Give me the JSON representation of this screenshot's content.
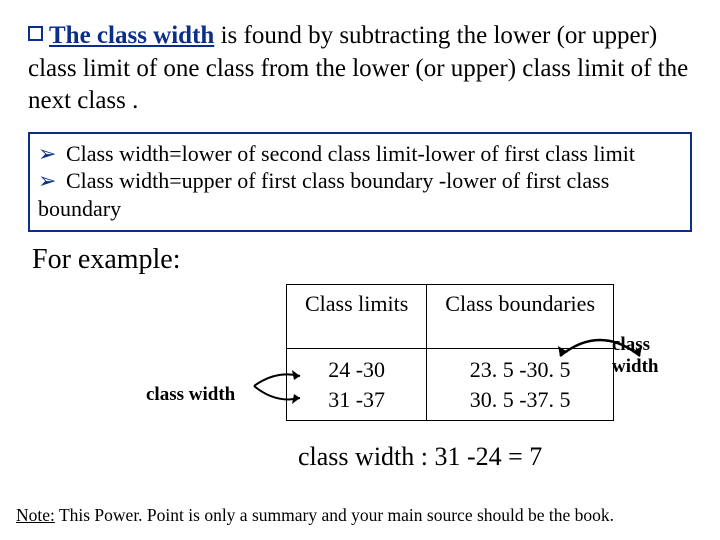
{
  "definition": {
    "term": "The class width",
    "rest": " is found by subtracting the lower (or upper) class limit of one class from the lower (or upper) class limit of the next class ."
  },
  "box": {
    "line1": "Class width=lower of second class limit-lower of first class limit",
    "line2": "Class width=upper of first class boundary -lower of first class boundary"
  },
  "example_label": "For example:",
  "table": {
    "headers": [
      "Class limits",
      "Class boundaries"
    ],
    "rows": [
      {
        "limits": [
          "24 -30",
          "31 -37"
        ],
        "boundaries": [
          "23. 5 -30. 5",
          "30. 5 -37. 5"
        ]
      }
    ]
  },
  "class_width_label": "class width",
  "equation": "class width :   31 -24 = 7",
  "note": {
    "label": "Note:",
    "text": " This Power. Point is only a summary and your main source should be the book."
  }
}
